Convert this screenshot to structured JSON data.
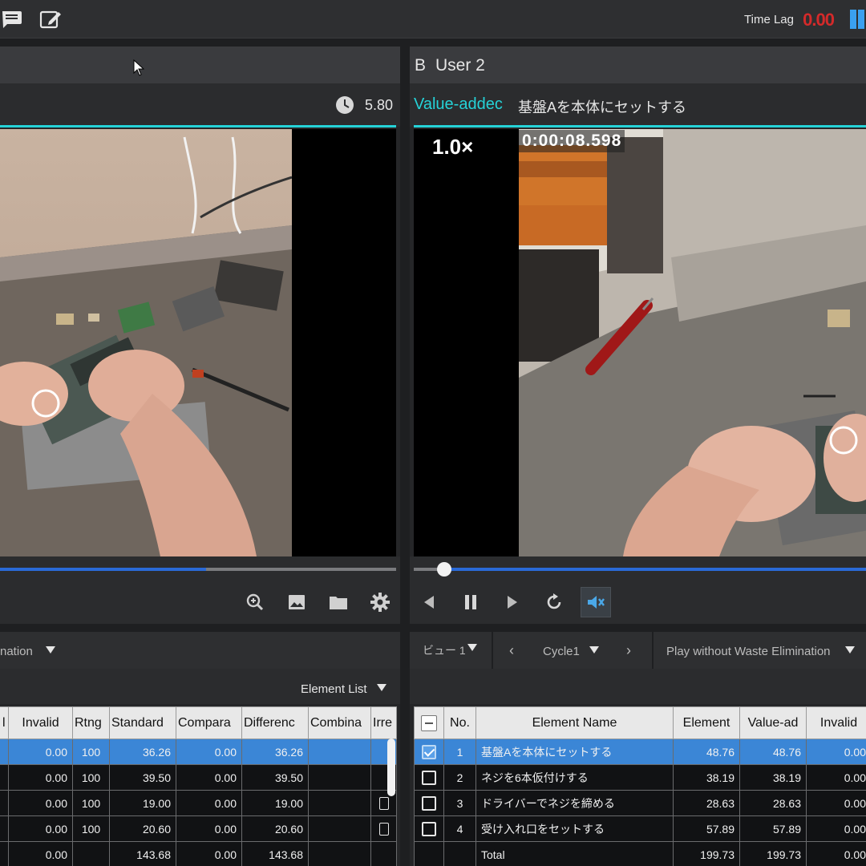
{
  "topbar": {
    "time_lag_label": "Time Lag",
    "time_lag_value": "0.00",
    "icons": [
      "comment-icon",
      "edit-icon",
      "layout-icon"
    ],
    "accent_color": "#d42a2a"
  },
  "panelA": {
    "clock_value": "5.80",
    "seek_progress": 0.52,
    "tools": [
      "zoom-in-icon",
      "image-icon",
      "folder-icon",
      "gear-icon"
    ]
  },
  "panelB": {
    "title_letter": "B",
    "title_user": "User 2",
    "category_label": "Value-addec",
    "element_label": "基盤Aを本体にセットする",
    "speed": "1.0×",
    "timestamp": "0:00:08.598",
    "seek_progress": 0.07,
    "controls": [
      "prev-icon",
      "pause-icon",
      "next-icon",
      "replay-icon",
      "mute-icon"
    ]
  },
  "tableA": {
    "filter_label": "nation",
    "element_list_label": "Element List",
    "columns": [
      "l",
      "Invalid",
      "Rtng",
      "Standard",
      "Compara",
      "Differenc",
      "Combina",
      "Irre"
    ],
    "rows": [
      {
        "invalid": "0.00",
        "rtng": "100",
        "standard": "36.26",
        "compara": "0.00",
        "diff": "36.26"
      },
      {
        "invalid": "0.00",
        "rtng": "100",
        "standard": "39.50",
        "compara": "0.00",
        "diff": "39.50"
      },
      {
        "invalid": "0.00",
        "rtng": "100",
        "standard": "19.00",
        "compara": "0.00",
        "diff": "19.00"
      },
      {
        "invalid": "0.00",
        "rtng": "100",
        "standard": "20.60",
        "compara": "0.00",
        "diff": "20.60"
      }
    ],
    "total": {
      "invalid": "0.00",
      "standard": "143.68",
      "compara": "0.00",
      "diff": "143.68"
    }
  },
  "tableB": {
    "view_label": "ビュー 1",
    "cycle_label": "Cycle1",
    "play_label": "Play without Waste Elimination",
    "columns": [
      "No.",
      "Element Name",
      "Element",
      "Value-ad",
      "Invalid"
    ],
    "rows": [
      {
        "no": "1",
        "name": "基盤Aを本体にセットする",
        "element": "48.76",
        "value_added": "48.76",
        "invalid": "0.00",
        "checked": true
      },
      {
        "no": "2",
        "name": "ネジを6本仮付けする",
        "element": "38.19",
        "value_added": "38.19",
        "invalid": "0.00",
        "checked": false
      },
      {
        "no": "3",
        "name": "ドライバーでネジを締める",
        "element": "28.63",
        "value_added": "28.63",
        "invalid": "0.00",
        "checked": false
      },
      {
        "no": "4",
        "name": "受け入れ口をセットする",
        "element": "57.89",
        "value_added": "57.89",
        "invalid": "0.00",
        "checked": false
      }
    ],
    "total": {
      "label": "Total",
      "element": "199.73",
      "value_added": "199.73",
      "invalid": "0.00"
    }
  }
}
